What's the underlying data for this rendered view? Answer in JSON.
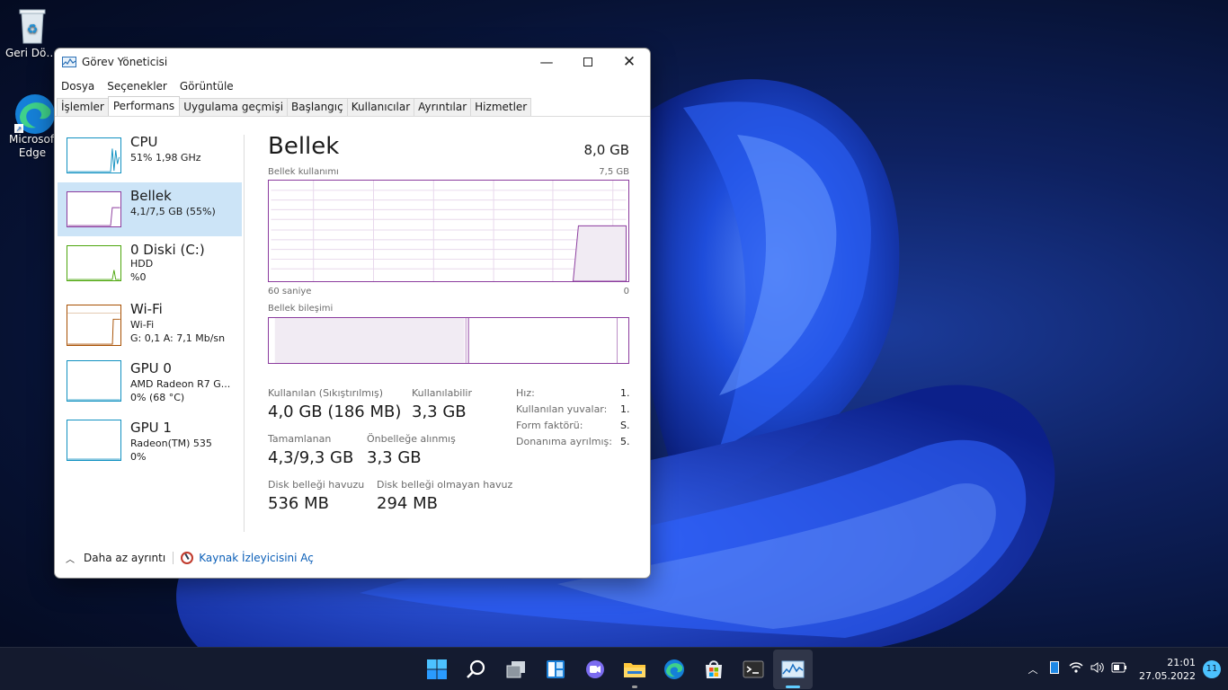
{
  "desktop": {
    "icons": [
      {
        "label": "Geri Dönüşü..."
      },
      {
        "label": "Microsoft Edge"
      }
    ]
  },
  "window": {
    "title": "Görev Yöneticisi",
    "menu": [
      "Dosya",
      "Seçenekler",
      "Görüntüle"
    ],
    "tabs": [
      "İşlemler",
      "Performans",
      "Uygulama geçmişi",
      "Başlangıç",
      "Kullanıcılar",
      "Ayrıntılar",
      "Hizmetler"
    ],
    "active_tab": "Performans"
  },
  "sidebar": {
    "items": [
      {
        "name": "CPU",
        "line1": "51%  1,98 GHz",
        "line2": "",
        "color": "#1191c1"
      },
      {
        "name": "Bellek",
        "line1": "4,1/7,5 GB (55%)",
        "line2": "",
        "color": "#8b3b9e"
      },
      {
        "name": "0 Diski (C:)",
        "line1": "HDD",
        "line2": "%0",
        "color": "#4da60c"
      },
      {
        "name": "Wi-Fi",
        "line1": "Wi-Fi",
        "line2": "G: 0,1  A: 7,1 Mb/sn",
        "color": "#a74f01"
      },
      {
        "name": "GPU 0",
        "line1": "AMD Radeon R7 G...",
        "line2": "0% (68 °C)",
        "color": "#1191c1"
      },
      {
        "name": "GPU 1",
        "line1": "Radeon(TM) 535",
        "line2": "0%",
        "color": "#1191c1"
      }
    ],
    "selected": "Bellek"
  },
  "main": {
    "title": "Bellek",
    "total": "8,0 GB",
    "usage_label": "Bellek kullanımı",
    "usage_max": "7,5 GB",
    "time_left": "60 saniye",
    "time_right": "0",
    "composition_label": "Bellek bileşimi",
    "stats": {
      "in_use_label": "Kullanılan (Sıkıştırılmış)",
      "in_use_value": "4,0 GB (186 MB)",
      "available_label": "Kullanılabilir",
      "available_value": "3,3 GB",
      "committed_label": "Tamamlanan",
      "committed_value": "4,3/9,3 GB",
      "cached_label": "Önbelleğe alınmış",
      "cached_value": "3,3 GB",
      "paged_label": "Disk belleği havuzu",
      "paged_value": "536 MB",
      "nonpaged_label": "Disk belleği olmayan havuz",
      "nonpaged_value": "294 MB"
    },
    "details": [
      {
        "label": "Hız:",
        "value": "1."
      },
      {
        "label": "Kullanılan yuvalar:",
        "value": "1."
      },
      {
        "label": "Form faktörü:",
        "value": "S."
      },
      {
        "label": "Donanıma ayrılmış:",
        "value": "5."
      }
    ],
    "usage_series": {
      "x_label_left": "60 saniye",
      "x_label_right": "0",
      "recent_fill_fraction": 0.55
    }
  },
  "footer": {
    "less_details": "Daha az ayrıntı",
    "resource_monitor": "Kaynak İzleyicisini Aç"
  },
  "taskbar": {
    "apps": [
      "start-icon",
      "search-icon",
      "task-view-icon",
      "widgets-icon",
      "chat-icon",
      "file-explorer-icon",
      "edge-icon",
      "store-icon",
      "terminal-icon",
      "task-manager-icon"
    ],
    "time": "21:01",
    "date": "27.05.2022",
    "notifications": "11"
  }
}
